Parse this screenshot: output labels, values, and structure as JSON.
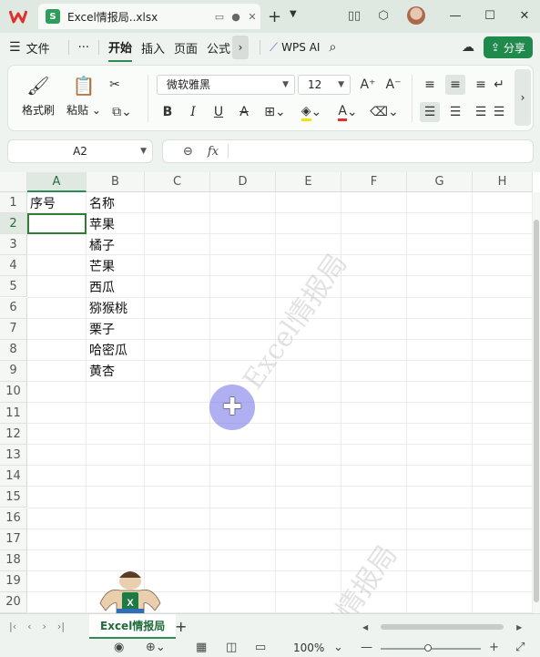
{
  "titlebar": {
    "logo": "W",
    "file_badge": "S",
    "file_name": "Excel情报局..xlsx",
    "new_tab": "+",
    "chevron": "⌄"
  },
  "menubar": {
    "file_label": "文件",
    "more": "···",
    "tabs": [
      "开始",
      "插入",
      "页面",
      "公式"
    ],
    "active_tab": "开始",
    "wps_ai": "WPS AI",
    "share": "分享"
  },
  "ribbon": {
    "format_painter": "格式刷",
    "paste": "粘贴",
    "font_name": "微软雅黑",
    "font_size": "12"
  },
  "formula_bar": {
    "name_box": "A2",
    "fx": "fx",
    "formula": ""
  },
  "grid": {
    "columns": [
      "A",
      "B",
      "C",
      "D",
      "E",
      "F",
      "G",
      "H"
    ],
    "selected_column": "A",
    "rows": [
      "1",
      "2",
      "3",
      "4",
      "5",
      "6",
      "7",
      "8",
      "9",
      "10",
      "11",
      "12",
      "13",
      "14",
      "15",
      "16",
      "17",
      "18",
      "19",
      "20"
    ],
    "selected_row": "2",
    "cells": {
      "A1": "序号",
      "B1": "名称",
      "B2": "苹果",
      "B3": "橘子",
      "B4": "芒果",
      "B5": "西瓜",
      "B6": "猕猴桃",
      "B7": "栗子",
      "B8": "哈密瓜",
      "B9": "黄杏"
    }
  },
  "watermark": "Excel情报局",
  "sheets": {
    "tabs": [
      "Excel情报局"
    ],
    "active": "Excel情报局",
    "add": "+"
  },
  "status": {
    "zoom": "100%"
  },
  "colors": {
    "accent": "#1f8a4c",
    "active_cell_border": "#2e7d32",
    "cursor_halo": "#6e6ee6"
  }
}
